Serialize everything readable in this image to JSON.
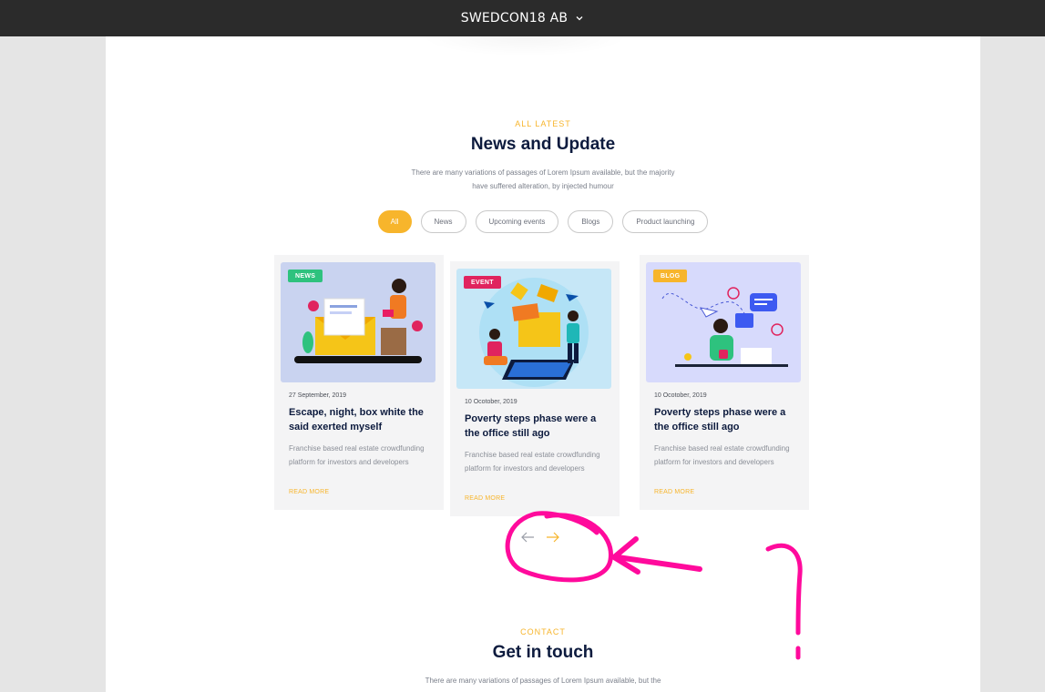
{
  "header": {
    "company": "SWEDCON18 AB"
  },
  "news": {
    "eyebrow": "ALL LATEST",
    "title": "News and Update",
    "subtitle": "There are many variations of passages of Lorem Ipsum available, but the majority have suffered alteration, by injected humour",
    "filters": [
      "All",
      "News",
      "Upcoming events",
      "Blogs",
      "Product launching"
    ],
    "active_filter": "All",
    "cards": [
      {
        "badge": "NEWS",
        "badge_color": "#2ec27e",
        "date": "27 September, 2019",
        "title": "Escape, night, box white the said exerted myself",
        "desc": "Franchise based real estate crowdfunding platform for investors and developers",
        "cta": "READ MORE"
      },
      {
        "badge": "EVENT",
        "badge_color": "#e0245e",
        "date": "10 Ocotober, 2019",
        "title": "Poverty steps phase were a the office still ago",
        "desc": "Franchise based real estate crowdfunding platform for investors and developers",
        "cta": "READ MORE"
      },
      {
        "badge": "BLOG",
        "badge_color": "#f7b52c",
        "date": "10 Ocotober, 2019",
        "title": "Poverty steps phase were a the office still ago",
        "desc": "Franchise based real estate crowdfunding platform for investors and developers",
        "cta": "READ MORE"
      }
    ],
    "nav": {
      "prev_icon": "arrow-left-icon",
      "next_icon": "arrow-right-icon"
    }
  },
  "contact": {
    "eyebrow": "CONTACT",
    "title": "Get in touch",
    "subtitle": "There are many variations of passages of Lorem Ipsum available, but the"
  },
  "colors": {
    "accent": "#f7b52c",
    "heading": "#0d1b3e",
    "annotation": "#ff0a9c"
  }
}
